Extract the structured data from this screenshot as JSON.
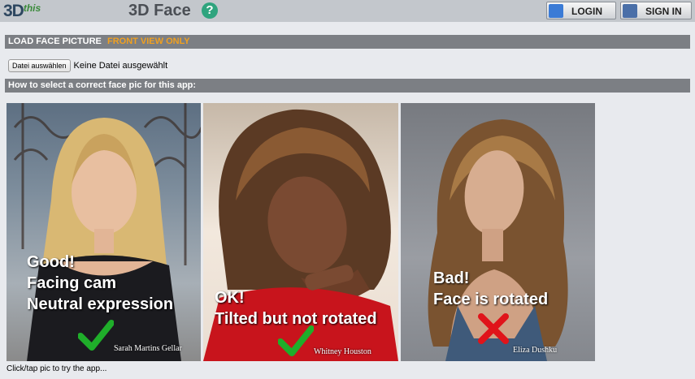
{
  "header": {
    "logo_main": "3D",
    "logo_sub": "this",
    "app_title": "3D Face",
    "help_label": "?",
    "login_label": "LOGIN",
    "signin_label": "SIGN IN"
  },
  "load_section": {
    "title": "LOAD FACE PICTURE",
    "note": "FRONT VIEW ONLY"
  },
  "file_input": {
    "button_label": "Datei auswählen",
    "status": "Keine Datei ausgewählt"
  },
  "guide_section": {
    "title": "How to select a correct face pic for this app:"
  },
  "examples": [
    {
      "lines": [
        "Good!",
        "Facing cam",
        "Neutral expression"
      ],
      "name": "Sarah Martins Gellar",
      "verdict": "check"
    },
    {
      "lines": [
        "OK!",
        "Tilted but not rotated"
      ],
      "name": "Whitney Houston",
      "verdict": "check"
    },
    {
      "lines": [
        "Bad!",
        "Face is rotated"
      ],
      "name": "Eliza Dushku",
      "verdict": "cross"
    }
  ],
  "footer": {
    "hint": "Click/tap pic to try the app..."
  },
  "colors": {
    "bar": "#7c7f84",
    "accent": "#f0a020",
    "check": "#1fae2a",
    "cross": "#e0141a",
    "help": "#2fa47e"
  }
}
